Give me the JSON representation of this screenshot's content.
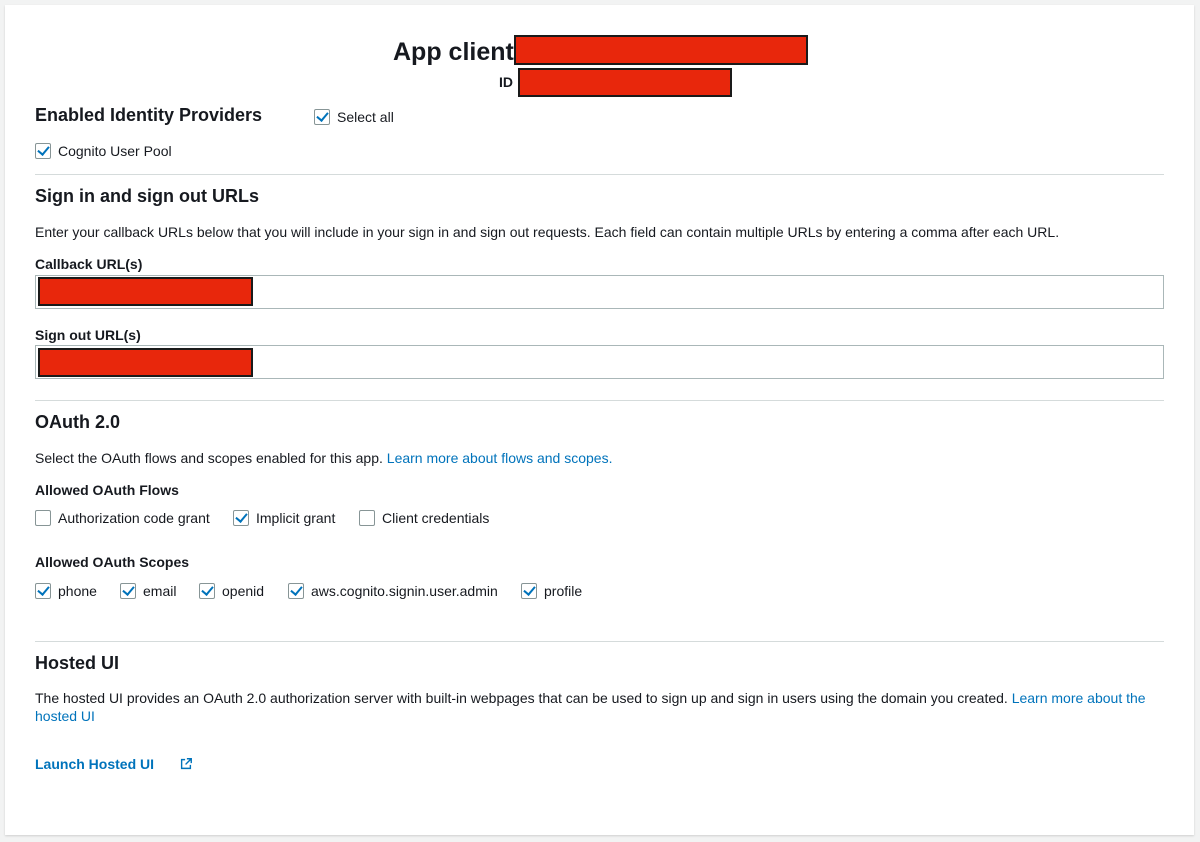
{
  "header": {
    "title": "App client",
    "id_label": "ID"
  },
  "identity_providers": {
    "heading": "Enabled Identity Providers",
    "select_all_label": "Select all",
    "select_all_checked": true,
    "providers": [
      {
        "label": "Cognito User Pool",
        "checked": true
      }
    ]
  },
  "urls": {
    "heading": "Sign in and sign out URLs",
    "description": "Enter your callback URLs below that you will include in your sign in and sign out requests. Each field can contain multiple URLs by entering a comma after each URL.",
    "callback_label": "Callback URL(s)",
    "signout_label": "Sign out URL(s)"
  },
  "oauth": {
    "heading": "OAuth 2.0",
    "description": "Select the OAuth flows and scopes enabled for this app.",
    "learn_more": "Learn more about flows and scopes.",
    "flows_heading": "Allowed OAuth Flows",
    "flows": [
      {
        "label": "Authorization code grant",
        "checked": false
      },
      {
        "label": "Implicit grant",
        "checked": true
      },
      {
        "label": "Client credentials",
        "checked": false
      }
    ],
    "scopes_heading": "Allowed OAuth Scopes",
    "scopes": [
      {
        "label": "phone",
        "checked": true
      },
      {
        "label": "email",
        "checked": true
      },
      {
        "label": "openid",
        "checked": true
      },
      {
        "label": "aws.cognito.signin.user.admin",
        "checked": true
      },
      {
        "label": "profile",
        "checked": true
      }
    ]
  },
  "hosted_ui": {
    "heading": "Hosted UI",
    "description": "The hosted UI provides an OAuth 2.0 authorization server with built-in webpages that can be used to sign up and sign in users using the domain you created.",
    "learn_more_line1": "Learn more about the",
    "learn_more_line2": "hosted UI",
    "launch_label": "Launch Hosted UI"
  },
  "colors": {
    "link": "#0073bb",
    "redaction": "#e8270c",
    "divider": "#d5dbdb"
  }
}
